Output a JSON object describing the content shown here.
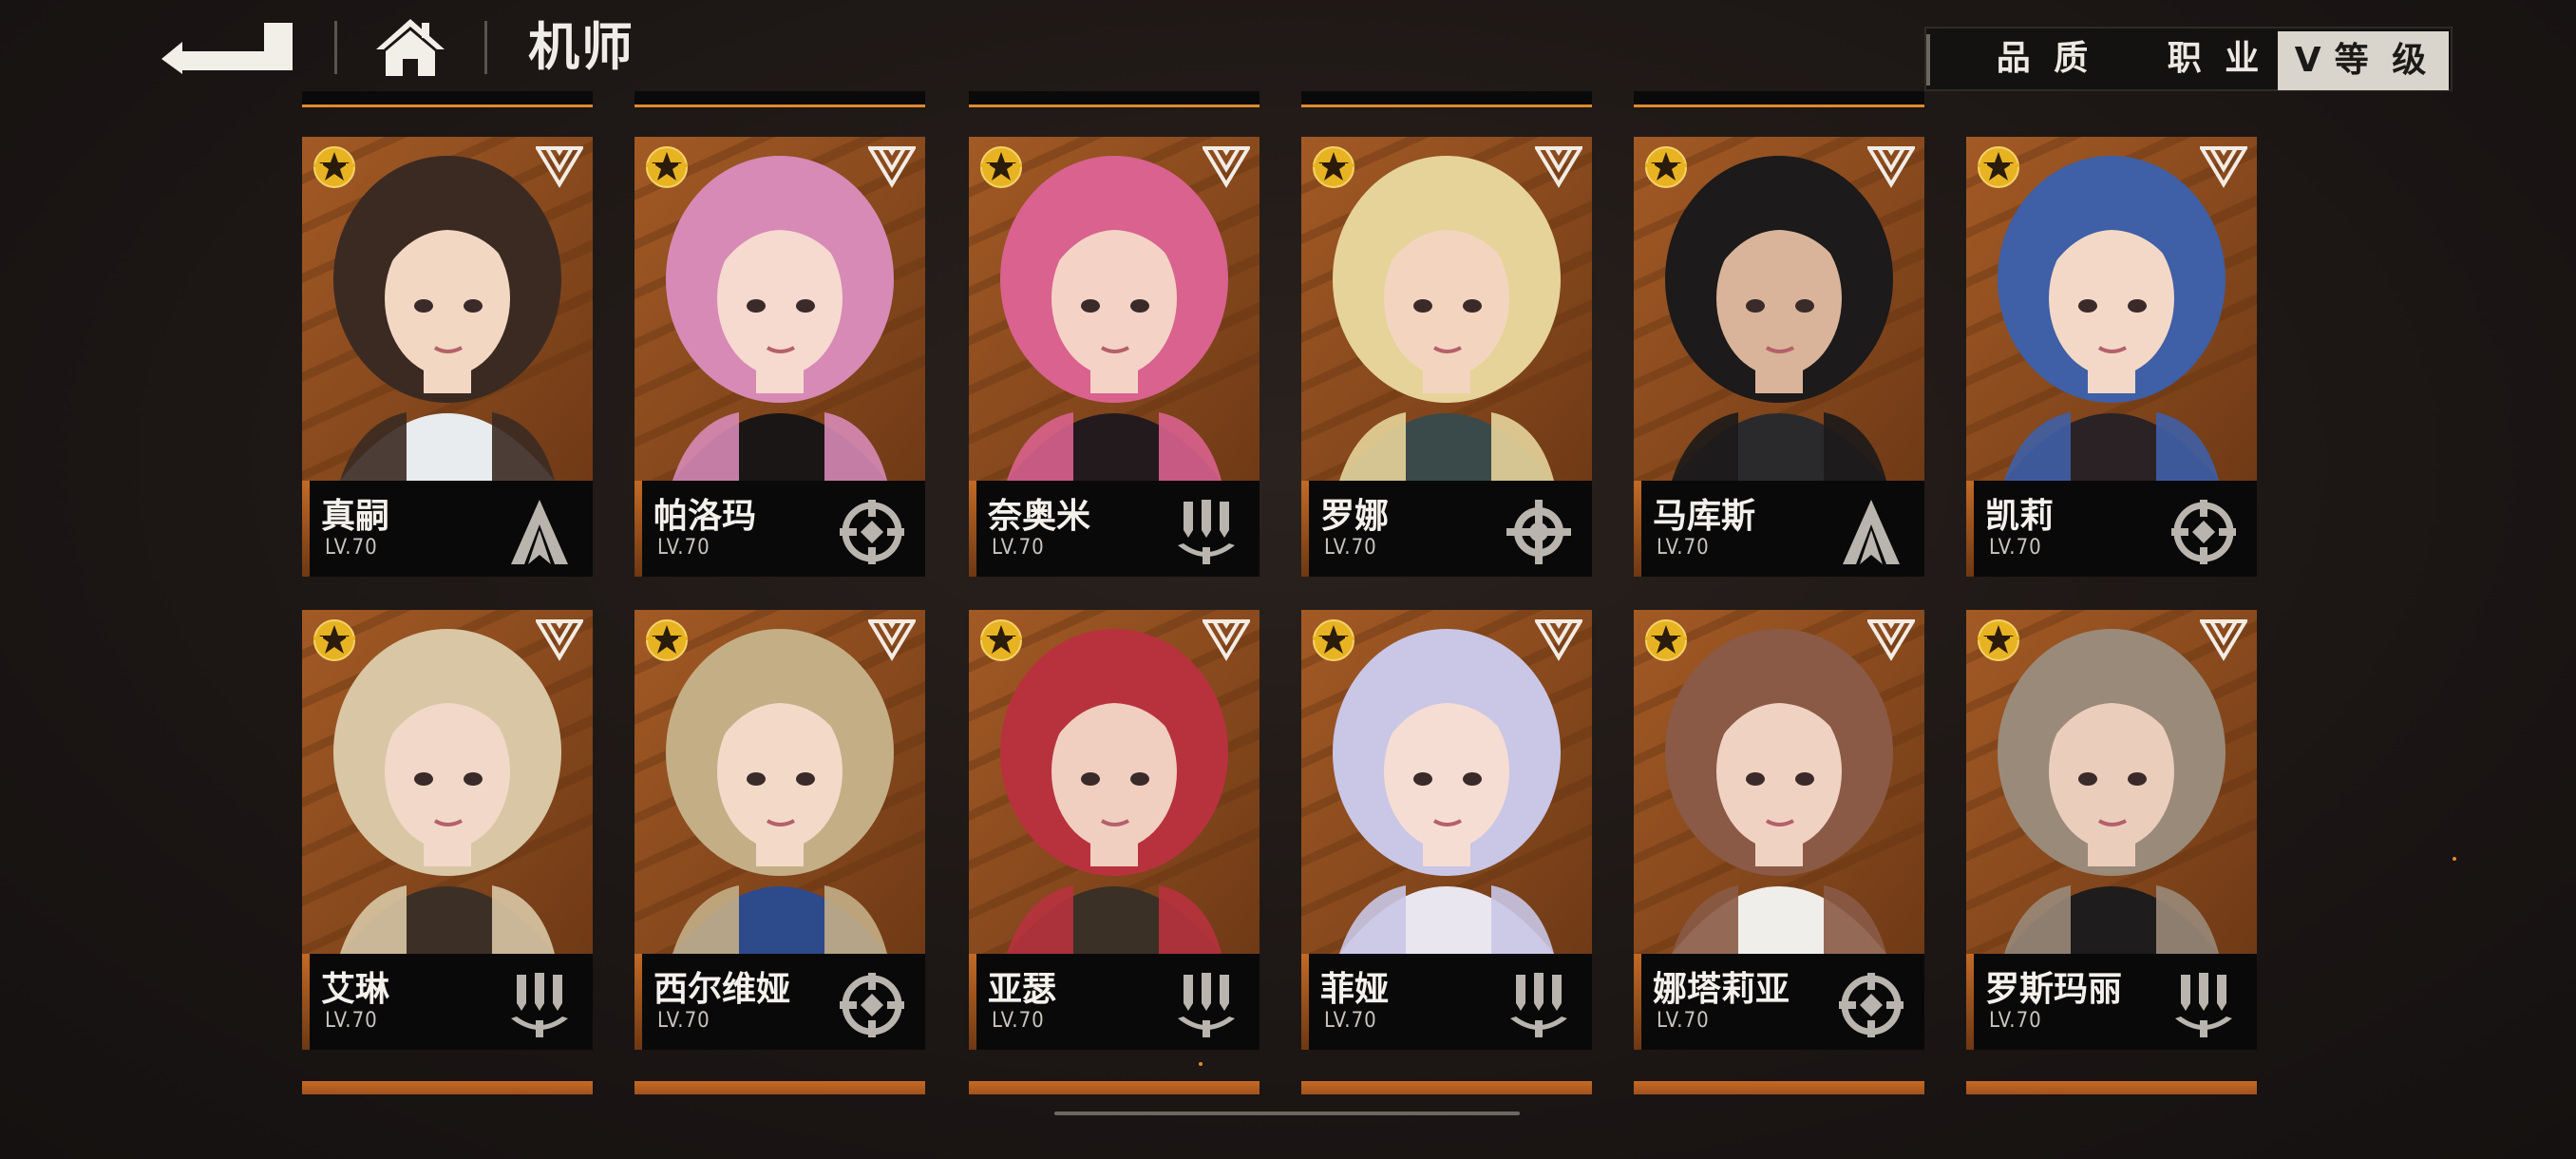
{
  "header": {
    "title": "机师",
    "back_icon": "back-arrow-icon",
    "home_icon": "home-icon"
  },
  "filters": {
    "quality_label": "品 质",
    "class_label": "职 业",
    "level_label": "等 级",
    "level_chevron": "V",
    "active": "level"
  },
  "colors": {
    "accent_orange": "#e08a2e",
    "card_bg": "#8a4e22",
    "infobar_bg": "#0a0909",
    "filter_active_bg": "#d9d4cc"
  },
  "pilots": [
    {
      "name": "真嗣",
      "level": "LV.70",
      "class_icon": "arrow-class-icon",
      "hair": "#3b2a22",
      "skin": "#f2d7c3",
      "outfit": "#e8ecef"
    },
    {
      "name": "帕洛玛",
      "level": "LV.70",
      "class_icon": "crosshair-class-icon",
      "hair": "#d78ab6",
      "skin": "#f6d9cf",
      "outfit": "#1a1616"
    },
    {
      "name": "奈奥米",
      "level": "LV.70",
      "class_icon": "missile-class-icon",
      "hair": "#d9628e",
      "skin": "#f4d3c6",
      "outfit": "#231a1e"
    },
    {
      "name": "罗娜",
      "level": "LV.70",
      "class_icon": "wrench-class-icon",
      "hair": "#e6d39a",
      "skin": "#f3d5bf",
      "outfit": "#3a4a4a"
    },
    {
      "name": "马库斯",
      "level": "LV.70",
      "class_icon": "arrow-class-icon",
      "hair": "#1c1a1a",
      "skin": "#d9b49a",
      "outfit": "#2a2a2c"
    },
    {
      "name": "凯莉",
      "level": "LV.70",
      "class_icon": "crosshair-class-icon",
      "hair": "#3f5fa6",
      "skin": "#f3d8c7",
      "outfit": "#2a2224"
    },
    {
      "name": "艾琳",
      "level": "LV.70",
      "class_icon": "missile-class-icon",
      "hair": "#d9c6a4",
      "skin": "#f2d8c8",
      "outfit": "#3c3026"
    },
    {
      "name": "西尔维娅",
      "level": "LV.70",
      "class_icon": "crosshair-class-icon",
      "hair": "#c4ae86",
      "skin": "#f3d9c8",
      "outfit": "#2d4a8a"
    },
    {
      "name": "亚瑟",
      "level": "LV.70",
      "class_icon": "missile-class-icon",
      "hair": "#b8323e",
      "skin": "#f0cfc0",
      "outfit": "#3a3026"
    },
    {
      "name": "菲娅",
      "level": "LV.70",
      "class_icon": "missile-class-icon",
      "hair": "#c9c6e6",
      "skin": "#f6ddd3",
      "outfit": "#e9e6ef"
    },
    {
      "name": "娜塔莉亚",
      "level": "LV.70",
      "class_icon": "crosshair-class-icon",
      "hair": "#8a5a46",
      "skin": "#f0d2c2",
      "outfit": "#f0eeea"
    },
    {
      "name": "罗斯玛丽",
      "level": "LV.70",
      "class_icon": "missile-class-icon",
      "hair": "#9a8a7a",
      "skin": "#ebcdbb",
      "outfit": "#1e1c1c"
    }
  ]
}
